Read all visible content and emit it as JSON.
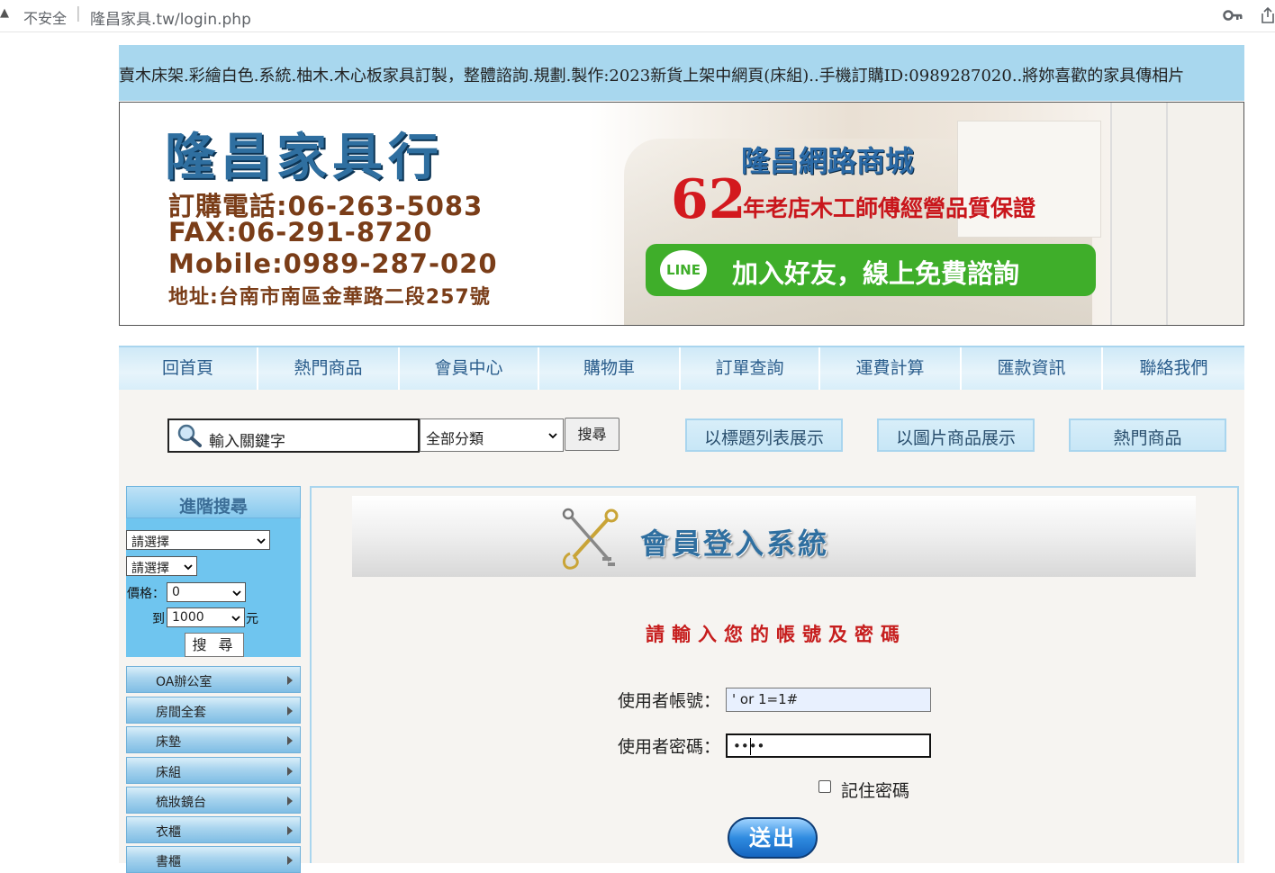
{
  "browser": {
    "warning_icon": "warning-icon",
    "security_label": "不安全",
    "separator": "|",
    "url": "隆昌家具.tw/login.php"
  },
  "marquee": {
    "text": "賣木床架.彩繪白色.系統.柚木.木心板家具訂製，整體諮詢.規劃.製作:2023新貨上架中網頁(床組)..手機訂購ID:0989287020..將妳喜歡的家具傳相片"
  },
  "banner": {
    "shop_name": "隆昌家具行",
    "tel": "訂購電話:06-263-5083",
    "fax": "FAX:06-291-8720",
    "mobile": "Mobile:0989-287-020",
    "address": "地址:台南市南區金華路二段257號",
    "mall_name": "隆昌網路商城",
    "years": "62",
    "quality": "年老店木工師傅經營品質保證",
    "line_logo": "LINE",
    "line_text": "加入好友，線上免費諮詢"
  },
  "nav": {
    "items": [
      "回首頁",
      "熱門商品",
      "會員中心",
      "購物車",
      "訂單查詢",
      "運費計算",
      "匯款資訊",
      "聯絡我們"
    ]
  },
  "search": {
    "keyword_placeholder": "輸入關鍵字",
    "category_selected": "全部分類",
    "button": "搜尋"
  },
  "views": {
    "list": "以標題列表展示",
    "image": "以圖片商品展示",
    "hot": "熱門商品"
  },
  "advanced": {
    "title": "進階搜尋",
    "select1": "請選擇",
    "select2": "請選擇",
    "price_label": "價格：",
    "price_min": "0",
    "to_label": "到",
    "price_max": "1000",
    "unit": "元",
    "button": "搜 尋"
  },
  "categories": [
    "OA辦公室",
    "房間全套",
    "床墊",
    "床組",
    "梳妝鏡台",
    "衣櫃",
    "書櫃"
  ],
  "login": {
    "title": "會員登入系統",
    "prompt": "請輸入您的帳號及密碼",
    "user_label": "使用者帳號：",
    "user_value": "' or 1=1#",
    "pass_label": "使用者密碼：",
    "pass_value": "••••",
    "remember": "記住密碼",
    "submit": "送出"
  },
  "colors": {
    "marquee_bg": "#a8d7ee",
    "nav_text": "#2a5d8c",
    "prompt_red": "#c61d1d",
    "line_green": "#3fae2a"
  }
}
